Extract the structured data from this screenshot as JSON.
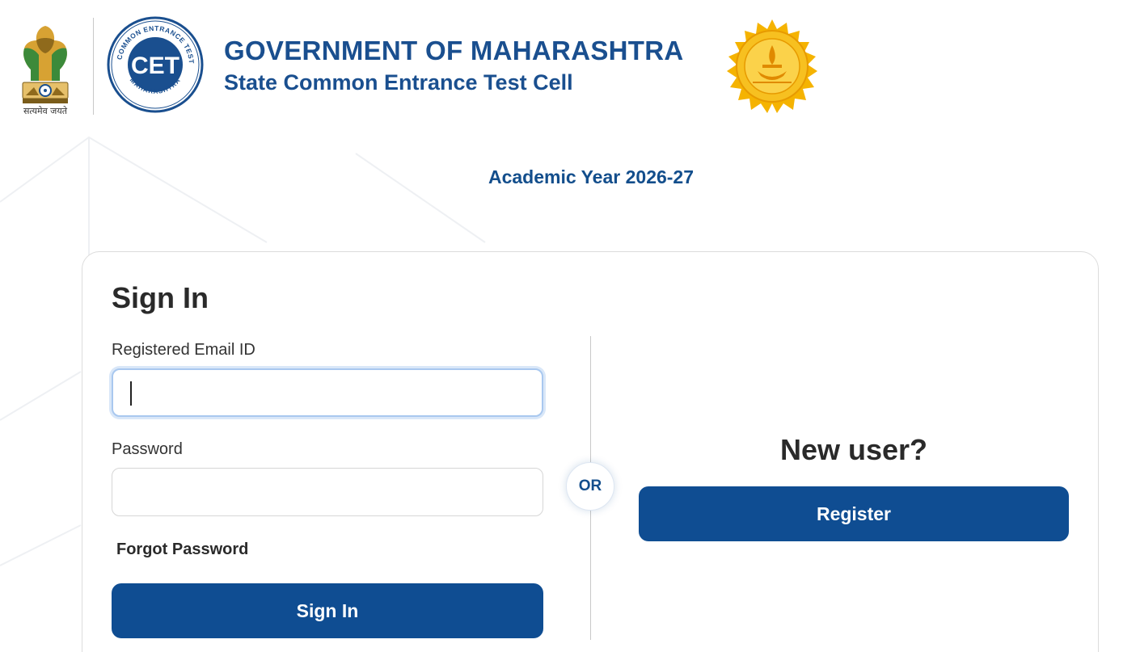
{
  "header": {
    "gov_title": "GOVERNMENT OF MAHARASHTRA",
    "gov_subtitle": "State Common Entrance Test Cell",
    "emblem_motto": "सत्यमेव जयते",
    "cet_logo_text": "CET",
    "cet_logo_ring_top": "STATE COMMON ENTRANCE TEST CELL",
    "cet_logo_ring_bottom": "MAHARASHTRA",
    "emblem_icon": "national-emblem-icon",
    "seal_icon": "maharashtra-seal-icon"
  },
  "academic_year": "Academic Year 2026-27",
  "signin": {
    "title": "Sign In",
    "email_label": "Registered Email ID",
    "email_value": "",
    "email_placeholder": "",
    "password_label": "Password",
    "password_value": "",
    "password_placeholder": "",
    "forgot_label": "Forgot Password",
    "button_label": "Sign In"
  },
  "divider": {
    "or_label": "OR"
  },
  "register": {
    "title": "New user?",
    "button_label": "Register"
  },
  "colors": {
    "primary": "#0f4d92",
    "heading_blue": "#1a4f8f",
    "seal_gold": "#f5b301"
  }
}
